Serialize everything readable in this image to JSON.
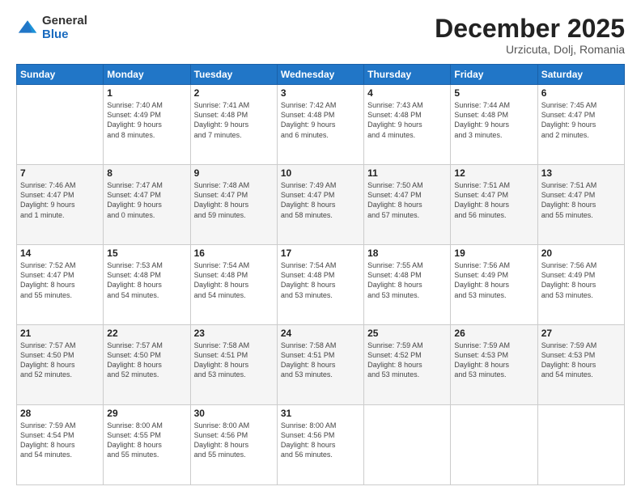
{
  "logo": {
    "general": "General",
    "blue": "Blue"
  },
  "header": {
    "month": "December 2025",
    "location": "Urzicuta, Dolj, Romania"
  },
  "weekdays": [
    "Sunday",
    "Monday",
    "Tuesday",
    "Wednesday",
    "Thursday",
    "Friday",
    "Saturday"
  ],
  "weeks": [
    [
      {
        "day": "",
        "lines": []
      },
      {
        "day": "1",
        "lines": [
          "Sunrise: 7:40 AM",
          "Sunset: 4:49 PM",
          "Daylight: 9 hours",
          "and 8 minutes."
        ]
      },
      {
        "day": "2",
        "lines": [
          "Sunrise: 7:41 AM",
          "Sunset: 4:48 PM",
          "Daylight: 9 hours",
          "and 7 minutes."
        ]
      },
      {
        "day": "3",
        "lines": [
          "Sunrise: 7:42 AM",
          "Sunset: 4:48 PM",
          "Daylight: 9 hours",
          "and 6 minutes."
        ]
      },
      {
        "day": "4",
        "lines": [
          "Sunrise: 7:43 AM",
          "Sunset: 4:48 PM",
          "Daylight: 9 hours",
          "and 4 minutes."
        ]
      },
      {
        "day": "5",
        "lines": [
          "Sunrise: 7:44 AM",
          "Sunset: 4:48 PM",
          "Daylight: 9 hours",
          "and 3 minutes."
        ]
      },
      {
        "day": "6",
        "lines": [
          "Sunrise: 7:45 AM",
          "Sunset: 4:47 PM",
          "Daylight: 9 hours",
          "and 2 minutes."
        ]
      }
    ],
    [
      {
        "day": "7",
        "lines": [
          "Sunrise: 7:46 AM",
          "Sunset: 4:47 PM",
          "Daylight: 9 hours",
          "and 1 minute."
        ]
      },
      {
        "day": "8",
        "lines": [
          "Sunrise: 7:47 AM",
          "Sunset: 4:47 PM",
          "Daylight: 9 hours",
          "and 0 minutes."
        ]
      },
      {
        "day": "9",
        "lines": [
          "Sunrise: 7:48 AM",
          "Sunset: 4:47 PM",
          "Daylight: 8 hours",
          "and 59 minutes."
        ]
      },
      {
        "day": "10",
        "lines": [
          "Sunrise: 7:49 AM",
          "Sunset: 4:47 PM",
          "Daylight: 8 hours",
          "and 58 minutes."
        ]
      },
      {
        "day": "11",
        "lines": [
          "Sunrise: 7:50 AM",
          "Sunset: 4:47 PM",
          "Daylight: 8 hours",
          "and 57 minutes."
        ]
      },
      {
        "day": "12",
        "lines": [
          "Sunrise: 7:51 AM",
          "Sunset: 4:47 PM",
          "Daylight: 8 hours",
          "and 56 minutes."
        ]
      },
      {
        "day": "13",
        "lines": [
          "Sunrise: 7:51 AM",
          "Sunset: 4:47 PM",
          "Daylight: 8 hours",
          "and 55 minutes."
        ]
      }
    ],
    [
      {
        "day": "14",
        "lines": [
          "Sunrise: 7:52 AM",
          "Sunset: 4:47 PM",
          "Daylight: 8 hours",
          "and 55 minutes."
        ]
      },
      {
        "day": "15",
        "lines": [
          "Sunrise: 7:53 AM",
          "Sunset: 4:48 PM",
          "Daylight: 8 hours",
          "and 54 minutes."
        ]
      },
      {
        "day": "16",
        "lines": [
          "Sunrise: 7:54 AM",
          "Sunset: 4:48 PM",
          "Daylight: 8 hours",
          "and 54 minutes."
        ]
      },
      {
        "day": "17",
        "lines": [
          "Sunrise: 7:54 AM",
          "Sunset: 4:48 PM",
          "Daylight: 8 hours",
          "and 53 minutes."
        ]
      },
      {
        "day": "18",
        "lines": [
          "Sunrise: 7:55 AM",
          "Sunset: 4:48 PM",
          "Daylight: 8 hours",
          "and 53 minutes."
        ]
      },
      {
        "day": "19",
        "lines": [
          "Sunrise: 7:56 AM",
          "Sunset: 4:49 PM",
          "Daylight: 8 hours",
          "and 53 minutes."
        ]
      },
      {
        "day": "20",
        "lines": [
          "Sunrise: 7:56 AM",
          "Sunset: 4:49 PM",
          "Daylight: 8 hours",
          "and 53 minutes."
        ]
      }
    ],
    [
      {
        "day": "21",
        "lines": [
          "Sunrise: 7:57 AM",
          "Sunset: 4:50 PM",
          "Daylight: 8 hours",
          "and 52 minutes."
        ]
      },
      {
        "day": "22",
        "lines": [
          "Sunrise: 7:57 AM",
          "Sunset: 4:50 PM",
          "Daylight: 8 hours",
          "and 52 minutes."
        ]
      },
      {
        "day": "23",
        "lines": [
          "Sunrise: 7:58 AM",
          "Sunset: 4:51 PM",
          "Daylight: 8 hours",
          "and 53 minutes."
        ]
      },
      {
        "day": "24",
        "lines": [
          "Sunrise: 7:58 AM",
          "Sunset: 4:51 PM",
          "Daylight: 8 hours",
          "and 53 minutes."
        ]
      },
      {
        "day": "25",
        "lines": [
          "Sunrise: 7:59 AM",
          "Sunset: 4:52 PM",
          "Daylight: 8 hours",
          "and 53 minutes."
        ]
      },
      {
        "day": "26",
        "lines": [
          "Sunrise: 7:59 AM",
          "Sunset: 4:53 PM",
          "Daylight: 8 hours",
          "and 53 minutes."
        ]
      },
      {
        "day": "27",
        "lines": [
          "Sunrise: 7:59 AM",
          "Sunset: 4:53 PM",
          "Daylight: 8 hours",
          "and 54 minutes."
        ]
      }
    ],
    [
      {
        "day": "28",
        "lines": [
          "Sunrise: 7:59 AM",
          "Sunset: 4:54 PM",
          "Daylight: 8 hours",
          "and 54 minutes."
        ]
      },
      {
        "day": "29",
        "lines": [
          "Sunrise: 8:00 AM",
          "Sunset: 4:55 PM",
          "Daylight: 8 hours",
          "and 55 minutes."
        ]
      },
      {
        "day": "30",
        "lines": [
          "Sunrise: 8:00 AM",
          "Sunset: 4:56 PM",
          "Daylight: 8 hours",
          "and 55 minutes."
        ]
      },
      {
        "day": "31",
        "lines": [
          "Sunrise: 8:00 AM",
          "Sunset: 4:56 PM",
          "Daylight: 8 hours",
          "and 56 minutes."
        ]
      },
      {
        "day": "",
        "lines": []
      },
      {
        "day": "",
        "lines": []
      },
      {
        "day": "",
        "lines": []
      }
    ]
  ]
}
